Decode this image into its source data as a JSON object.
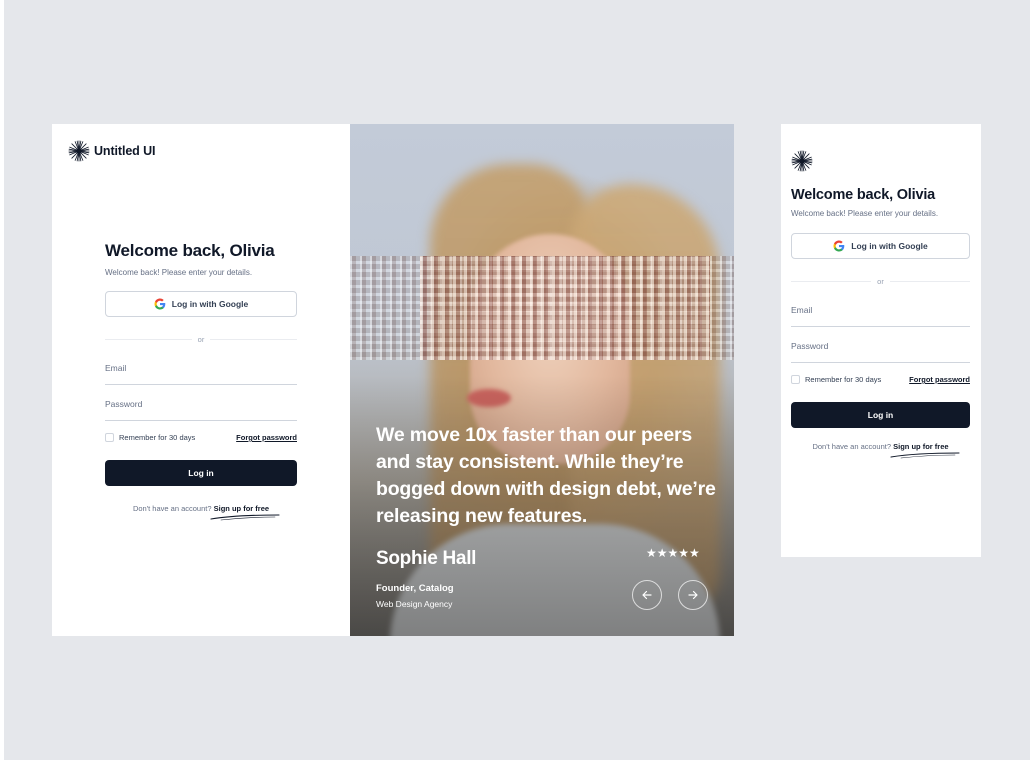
{
  "brand": {
    "name": "Untitled UI"
  },
  "login": {
    "title": "Welcome back, Olivia",
    "subtitle": "Welcome back! Please enter your details.",
    "google_label": "Log in with Google",
    "divider": "or",
    "email_placeholder": "Email",
    "password_placeholder": "Password",
    "remember_label": "Remember for 30 days",
    "forgot_label": "Forgot password",
    "login_label": "Log in",
    "signup_prompt": "Don't have an account?",
    "signup_link": "Sign up for free"
  },
  "testimonial": {
    "quote": "We move 10x faster than our peers and stay consistent. While they’re bogged down with design debt, we’re releasing new features.",
    "name": "Sophie Hall",
    "role": "Founder, Catalog",
    "company": "Web Design Agency",
    "rating": 5,
    "stars": "★★★★★",
    "prev_icon": "arrow-left-icon",
    "next_icon": "arrow-right-icon"
  },
  "colors": {
    "primary": "#101828",
    "muted": "#667085",
    "border": "#d0d5dd",
    "backdrop": "#e5e7eb"
  }
}
